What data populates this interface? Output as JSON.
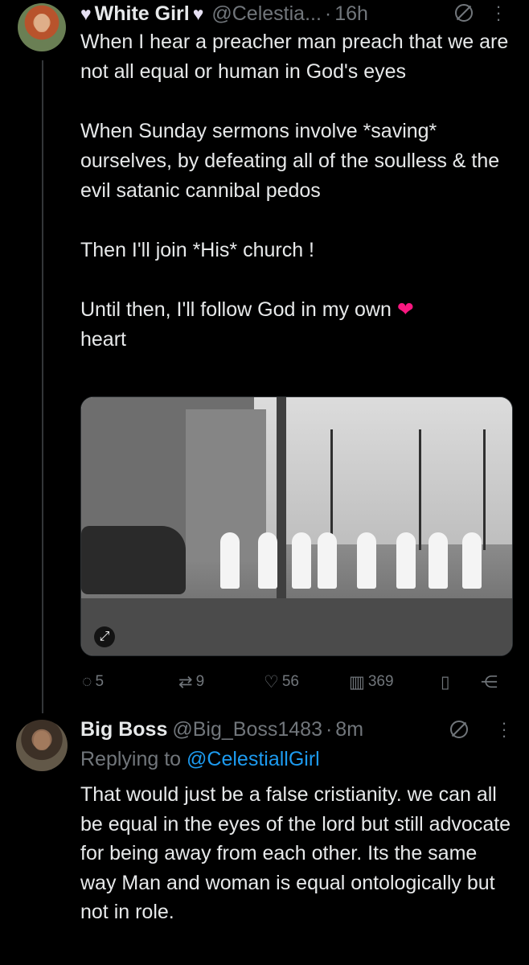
{
  "tweet": {
    "display_name": "White Girl",
    "name_icon": "white-heart-icon",
    "handle": "@Celestia...",
    "separator": "·",
    "time": "16h",
    "paragraphs": [
      "When I hear a preacher man preach that we are not all equal or human in God's eyes",
      "When Sunday sermons involve *saving* ourselves, by defeating all of the soulless & the evil satanic cannibal pedos",
      "Then I'll join *His* church !",
      "Until then, I'll follow God in my own"
    ],
    "final_emoji": "❤",
    "final_word": "heart",
    "media": {
      "icon": "expand-icon"
    },
    "actions": {
      "replies": "5",
      "reposts": "9",
      "likes": "56",
      "views": "369"
    }
  },
  "reply": {
    "display_name": "Big Boss",
    "handle": "@Big_Boss1483",
    "separator": "·",
    "time": "8m",
    "replying_prefix": "Replying to",
    "replying_to": "@CelestiallGirl",
    "text": "That would just be a false cristianity. we can all be equal in the eyes of the lord but still advocate for being away from each other. Its the same way Man and woman is equal ontologically but not in role."
  },
  "colors": {
    "background": "#000000",
    "text": "#e7e9ea",
    "muted": "#71767b",
    "link": "#1d9bf0",
    "heart": "#f91880"
  }
}
